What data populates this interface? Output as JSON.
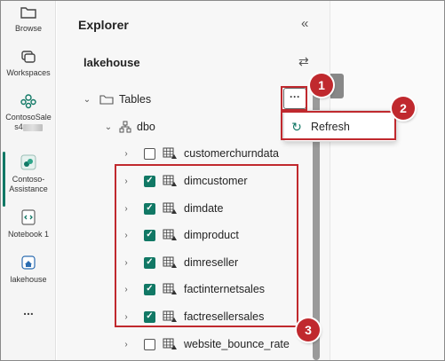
{
  "rail": {
    "items": [
      {
        "label": "Browse",
        "icon": "folder-icon"
      },
      {
        "label": "Workspaces",
        "icon": "workspaces-icon"
      },
      {
        "label": "ContosoSale",
        "label2": "s4",
        "icon": "people-icon"
      },
      {
        "label": "Contoso-",
        "label2": "Assistance",
        "icon": "contoso-app-icon"
      },
      {
        "label": "Notebook 1",
        "icon": "notebook-icon"
      },
      {
        "label": "lakehouse",
        "icon": "lakehouse-icon"
      },
      {
        "label": "...",
        "icon": "more-icon"
      }
    ]
  },
  "explorer": {
    "title": "Explorer",
    "collapse_glyph": "«",
    "lakehouse_title": "lakehouse",
    "swap_glyph": "⇄",
    "tables_label": "Tables",
    "more_glyph": "···",
    "schema_label": "dbo",
    "tables": [
      {
        "name": "customerchurndata",
        "checked": false
      },
      {
        "name": "dimcustomer",
        "checked": true
      },
      {
        "name": "dimdate",
        "checked": true
      },
      {
        "name": "dimproduct",
        "checked": true
      },
      {
        "name": "dimreseller",
        "checked": true
      },
      {
        "name": "factinternetsales",
        "checked": true
      },
      {
        "name": "factresellersales",
        "checked": true
      },
      {
        "name": "website_bounce_rate",
        "checked": false
      }
    ]
  },
  "context_menu": {
    "refresh_label": "Refresh"
  },
  "annotations": {
    "badge1": "1",
    "badge2": "2",
    "badge3": "3",
    "color": "#c0292e"
  },
  "colors": {
    "accent": "#117865"
  }
}
